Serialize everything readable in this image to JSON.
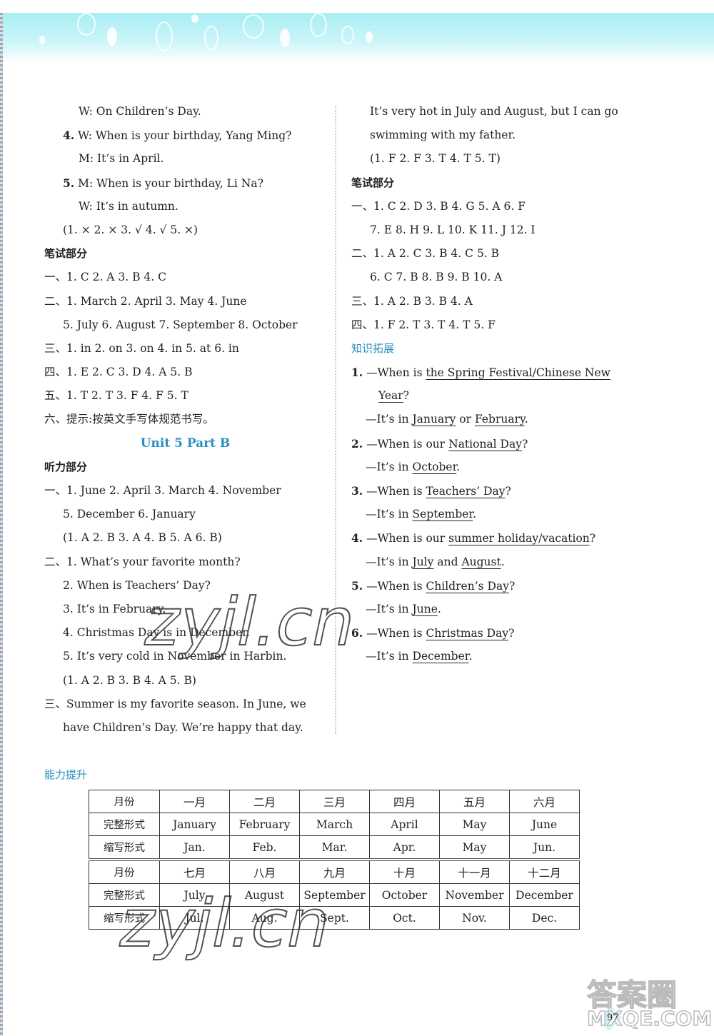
{
  "left_column": {
    "listening_tail": [
      {
        "speaker": "W:",
        "text": "On Children’s Day."
      },
      {
        "num": "4.",
        "speaker": "W:",
        "text": "When is your birthday, Yang Ming?"
      },
      {
        "speaker": "M:",
        "text": "It’s in April."
      },
      {
        "num": "5.",
        "speaker": "M:",
        "text": "When is your birthday, Li Na?"
      },
      {
        "speaker": "W:",
        "text": "It’s in autumn."
      }
    ],
    "listening_answers": "(1. ×   2. ×   3. √   4. √   5. ×)",
    "written_heading": "笔试部分",
    "written": [
      {
        "marker": "一、",
        "text": "1. C   2. A   3. B   4. C"
      },
      {
        "marker": "二、",
        "text": "1.  March    2.  April    3.  May    4.  June"
      },
      {
        "marker": "",
        "text": "5. July   6. August   7. September   8. October"
      },
      {
        "marker": "三、",
        "text": "1. in   2. on   3. on   4. in   5. at   6. in"
      },
      {
        "marker": "四、",
        "text": "1. E   2. C   3. D   4. A   5. B"
      },
      {
        "marker": "五、",
        "text": "1. T   2. T   3. F   4. F   5. T"
      },
      {
        "marker": "六、",
        "text": "提示:按英文手写体规范书写。"
      }
    ],
    "unit_title": "Unit 5    Part B",
    "listening_heading": "听力部分",
    "part_b_listening": [
      {
        "marker": "一、",
        "text": "1. June   2. April   3. March   4. November"
      },
      {
        "marker": "",
        "text": "5. December   6. January"
      },
      {
        "marker": "",
        "text": "(1. A   2. B   3. A   4. B   5. A   6. B)"
      },
      {
        "marker": "二、",
        "text": "1. What’s your favorite month?"
      },
      {
        "marker": "",
        "text": "2. When is Teachers’ Day?"
      },
      {
        "marker": "",
        "text": "3. It’s in February."
      },
      {
        "marker": "",
        "text": "4. Christmas Day is in December."
      },
      {
        "marker": "",
        "text": "5. It’s very cold in November in Harbin."
      },
      {
        "marker": "",
        "text": "(1. A   2. B   3. B   4. A   5. B)"
      },
      {
        "marker": "三、",
        "text": "Summer is my favorite season. In June, we"
      },
      {
        "marker": "",
        "text": "have Children’s Day. We’re happy that day."
      }
    ]
  },
  "right_column": {
    "passage": [
      "It’s very hot in July and August, but I can go",
      "swimming with my father."
    ],
    "passage_answers": "(1. F   2. F   3. T   4. T   5. T)",
    "written_heading": "笔试部分",
    "written": [
      {
        "marker": "一、",
        "text": "1. C   2. D   3. B   4. G   5. A   6. F"
      },
      {
        "marker": "",
        "text": "7. E   8. H   9. L   10. K   11. J   12. I"
      },
      {
        "marker": "二、",
        "text": "1. A   2. C   3. B   4. C   5. B"
      },
      {
        "marker": "",
        "text": "6. C   7. B   8. B   9. B   10. A"
      },
      {
        "marker": "三、",
        "text": "1. A   2. B   3. B   4. A"
      },
      {
        "marker": "四、",
        "text": "1. F   2. T   3. T   4. T   5. F"
      }
    ],
    "extension_heading": "知识拓展",
    "extension": [
      {
        "num": "1.",
        "q_prefix": "—When is ",
        "q_answer": "the Spring Festival/Chinese New",
        "q_suffix": ""
      },
      {
        "cont_answer": "Year",
        "cont_suffix": "?"
      },
      {
        "a_prefix": "—It’s in ",
        "a_parts": [
          "January",
          " or ",
          "February"
        ],
        "a_suffix": "."
      },
      {
        "num": "2.",
        "q_prefix": "—When is our ",
        "q_answer": "National Day",
        "q_suffix": "?"
      },
      {
        "a_prefix": "—It’s in ",
        "a_parts": [
          "October"
        ],
        "a_suffix": "."
      },
      {
        "num": "3.",
        "q_prefix": "—When is ",
        "q_answer": "Teachers’ Day",
        "q_suffix": "?"
      },
      {
        "a_prefix": "—It’s in ",
        "a_parts": [
          "September"
        ],
        "a_suffix": "."
      },
      {
        "num": "4.",
        "q_prefix": "—When is our ",
        "q_answer": "summer holiday/vacation",
        "q_suffix": "?"
      },
      {
        "a_prefix": "—It’s in ",
        "a_parts": [
          "July",
          " and ",
          "August"
        ],
        "a_suffix": "."
      },
      {
        "num": "5.",
        "q_prefix": "—When is ",
        "q_answer": "Children’s Day",
        "q_suffix": "?"
      },
      {
        "a_prefix": "—It’s in ",
        "a_parts": [
          "June"
        ],
        "a_suffix": "."
      },
      {
        "num": "6.",
        "q_prefix": "—When is ",
        "q_answer": "Christmas Day",
        "q_suffix": "?"
      },
      {
        "a_prefix": "—It’s in ",
        "a_parts": [
          "December"
        ],
        "a_suffix": "."
      }
    ]
  },
  "ability": {
    "heading": "能力提升",
    "row_labels": [
      "月份",
      "完整形式",
      "缩写形式"
    ],
    "months_cn": [
      "一月",
      "二月",
      "三月",
      "四月",
      "五月",
      "六月",
      "七月",
      "八月",
      "九月",
      "十月",
      "十一月",
      "十二月"
    ],
    "full": [
      "January",
      "February",
      "March",
      "April",
      "May",
      "June",
      "July",
      "August",
      "September",
      "October",
      "November",
      "December"
    ],
    "abbr": [
      "Jan.",
      "Feb.",
      "Mar.",
      "Apr.",
      "May",
      "Jun.",
      "Jul.",
      "Aug.",
      "Sept.",
      "Oct.",
      "Nov.",
      "Dec."
    ]
  },
  "page_number": "97",
  "watermarks": {
    "zyjl": "zyjl.cn",
    "mxqe_cn": "答案圈",
    "mxqe": "MXQE.COM"
  },
  "colors": {
    "accent_blue": "#2a8fc0",
    "banner_cyan": "#a8eef4"
  }
}
